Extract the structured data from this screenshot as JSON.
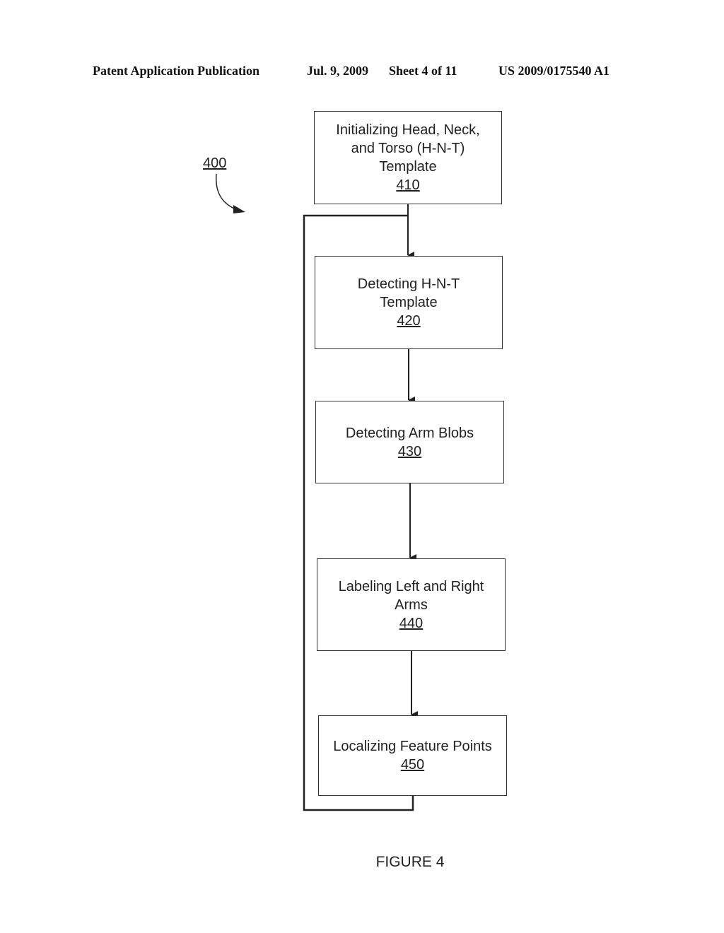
{
  "header": {
    "publication": "Patent Application Publication",
    "date": "Jul. 9, 2009",
    "sheet": "Sheet 4 of 11",
    "number": "US 2009/0175540 A1"
  },
  "diagram": {
    "reference": "400",
    "steps": [
      {
        "lines": [
          "Initializing Head, Neck,",
          "and Torso (H-N-T)",
          "Template"
        ],
        "id": "410"
      },
      {
        "lines": [
          "Detecting H-N-T",
          "Template"
        ],
        "id": "420"
      },
      {
        "lines": [
          "Detecting Arm Blobs"
        ],
        "id": "430"
      },
      {
        "lines": [
          "Labeling Left and Right",
          "Arms"
        ],
        "id": "440"
      },
      {
        "lines": [
          "Localizing Feature Points"
        ],
        "id": "450"
      }
    ],
    "loop": "450 returns to 420"
  },
  "figure_label": "FIGURE 4"
}
